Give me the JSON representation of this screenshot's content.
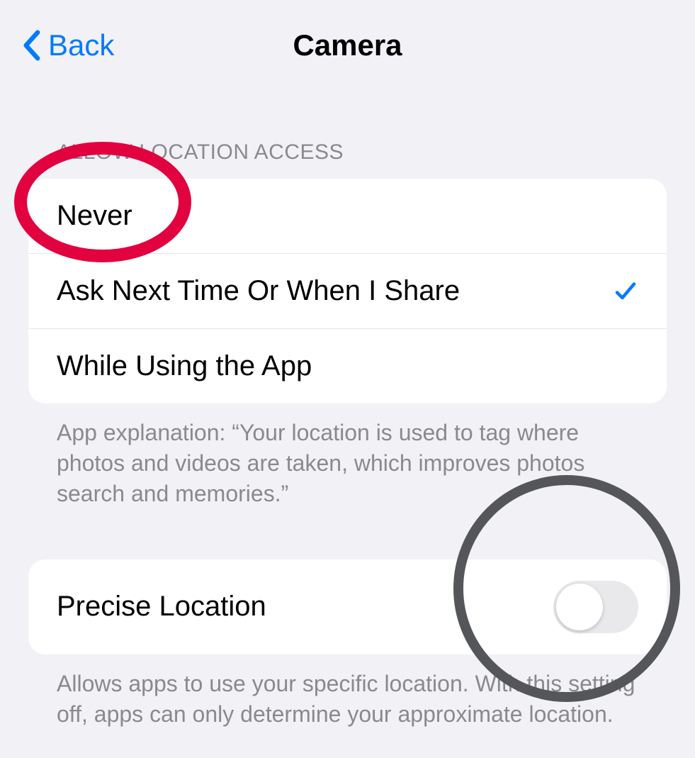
{
  "header": {
    "back_label": "Back",
    "title": "Camera"
  },
  "location_access": {
    "section_header": "ALLOW LOCATION ACCESS",
    "options": [
      {
        "label": "Never",
        "selected": false
      },
      {
        "label": "Ask Next Time Or When I Share",
        "selected": true
      },
      {
        "label": "While Using the App",
        "selected": false
      }
    ],
    "footer": "App explanation: “Your location is used to tag where photos and videos are taken, which improves photos search and memories.”"
  },
  "precise_location": {
    "label": "Precise Location",
    "enabled": false,
    "footer": "Allows apps to use your specific location. With this setting off, apps can only determine your approximate location."
  }
}
